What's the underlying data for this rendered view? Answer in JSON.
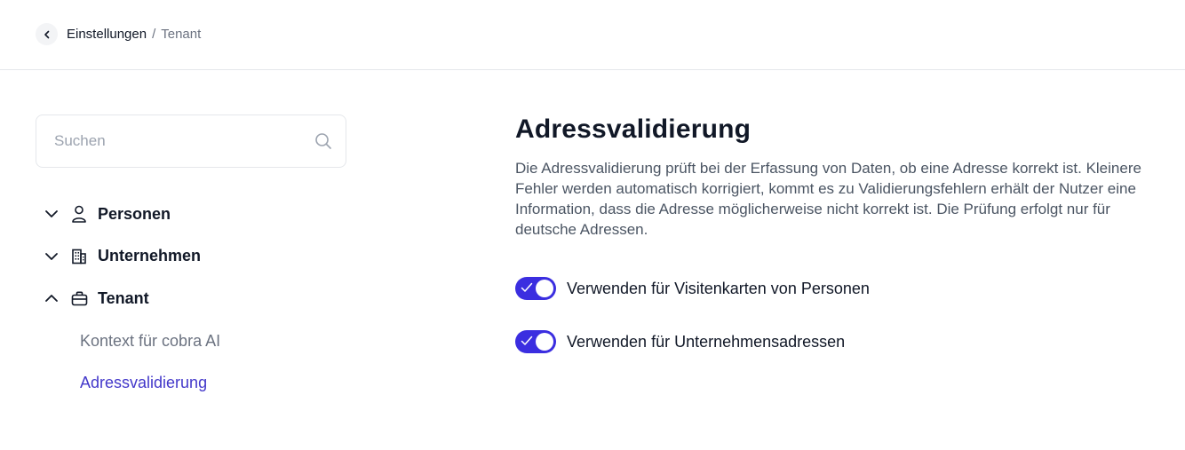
{
  "breadcrumb": {
    "parent": "Einstellungen",
    "separator": "/",
    "current": "Tenant"
  },
  "search": {
    "placeholder": "Suchen",
    "value": ""
  },
  "nav": {
    "groups": [
      {
        "label": "Personen",
        "icon": "person-icon",
        "expanded": false
      },
      {
        "label": "Unternehmen",
        "icon": "building-icon",
        "expanded": false
      },
      {
        "label": "Tenant",
        "icon": "briefcase-icon",
        "expanded": true,
        "items": [
          {
            "label": "Kontext für cobra AI",
            "active": false
          },
          {
            "label": "Adressvalidierung",
            "active": true
          }
        ]
      }
    ]
  },
  "main": {
    "title": "Adressvalidierung",
    "description": "Die Adressvalidierung prüft bei der Erfassung von Daten, ob eine Adresse korrekt ist. Kleinere Fehler werden automatisch korrigiert, kommt es zu Validierungsfehlern erhält der Nutzer eine Information, dass die Adresse möglicherweise nicht korrekt ist. Die Prüfung erfolgt nur für deutsche Adressen.",
    "toggles": [
      {
        "label": "Verwenden für Visitenkarten von Personen",
        "checked": true
      },
      {
        "label": "Verwenden für Unternehmensadressen",
        "checked": true
      }
    ]
  },
  "colors": {
    "accent": "#3b2ee0",
    "active_link": "#4338ca",
    "muted_text": "#6b7280"
  }
}
